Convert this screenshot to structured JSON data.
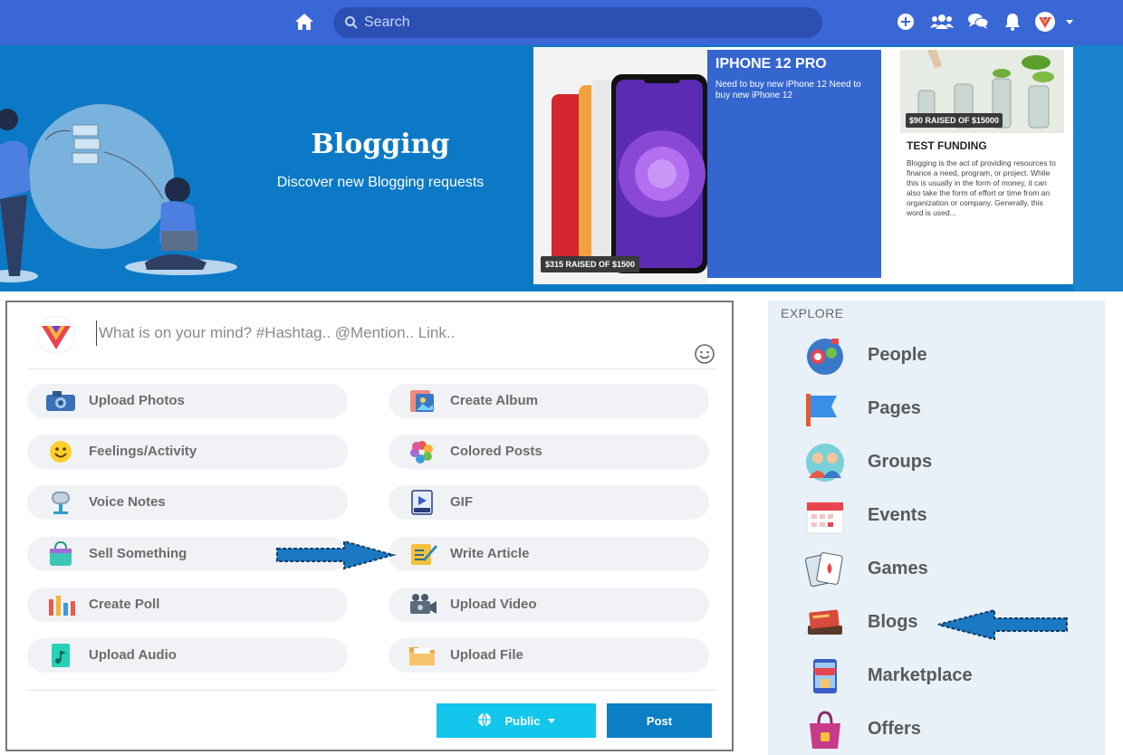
{
  "topbar": {
    "search_placeholder": "Search",
    "icons": [
      "home-icon",
      "add-icon",
      "friends-icon",
      "messages-icon",
      "notifications-icon",
      "avatar",
      "caret-down-icon"
    ],
    "color": "#3a67d6"
  },
  "banner": {
    "title": "Blogging",
    "subtitle": "Discover new Blogging requests"
  },
  "campaign1": {
    "raised": "$315 RAISED OF $1500",
    "title": "IPHONE 12 PRO",
    "description": "Need to buy new iPhone 12 Need to buy new iPhone 12"
  },
  "campaign2": {
    "raised": "$90 RAISED OF $15000",
    "title": "TEST FUNDING",
    "description": "Blogging is the act of providing resources to finance a need, program, or project. While this is usually in the form of money, it can also take the form of effort or time from an organization or company. Generally, this word is used..."
  },
  "composer": {
    "placeholder": "What is on your mind? #Hashtag.. @Mention.. Link..",
    "options": [
      {
        "label": "Upload Photos",
        "icon": "camera-icon"
      },
      {
        "label": "Create Album",
        "icon": "album-icon"
      },
      {
        "label": "Feelings/Activity",
        "icon": "smiley-icon"
      },
      {
        "label": "Colored Posts",
        "icon": "color-palette-icon"
      },
      {
        "label": "Voice Notes",
        "icon": "microphone-icon"
      },
      {
        "label": "GIF",
        "icon": "gif-icon"
      },
      {
        "label": "Sell Something",
        "icon": "shopping-bag-icon"
      },
      {
        "label": "Write Article",
        "icon": "article-icon"
      },
      {
        "label": "Create Poll",
        "icon": "poll-icon"
      },
      {
        "label": "Upload Video",
        "icon": "video-camera-icon"
      },
      {
        "label": "Upload Audio",
        "icon": "audio-file-icon"
      },
      {
        "label": "Upload File",
        "icon": "folder-icon"
      }
    ],
    "public_label": "Public",
    "post_label": "Post"
  },
  "explore": {
    "title": "EXPLORE",
    "items": [
      {
        "label": "People",
        "icon": "people-icon"
      },
      {
        "label": "Pages",
        "icon": "flag-icon"
      },
      {
        "label": "Groups",
        "icon": "groups-icon"
      },
      {
        "label": "Events",
        "icon": "calendar-icon"
      },
      {
        "label": "Games",
        "icon": "cards-icon"
      },
      {
        "label": "Blogs",
        "icon": "book-icon"
      },
      {
        "label": "Marketplace",
        "icon": "store-icon"
      },
      {
        "label": "Offers",
        "icon": "offer-bag-icon"
      }
    ]
  },
  "annotations": [
    "arrow-to-write-article",
    "arrow-to-blogs"
  ]
}
